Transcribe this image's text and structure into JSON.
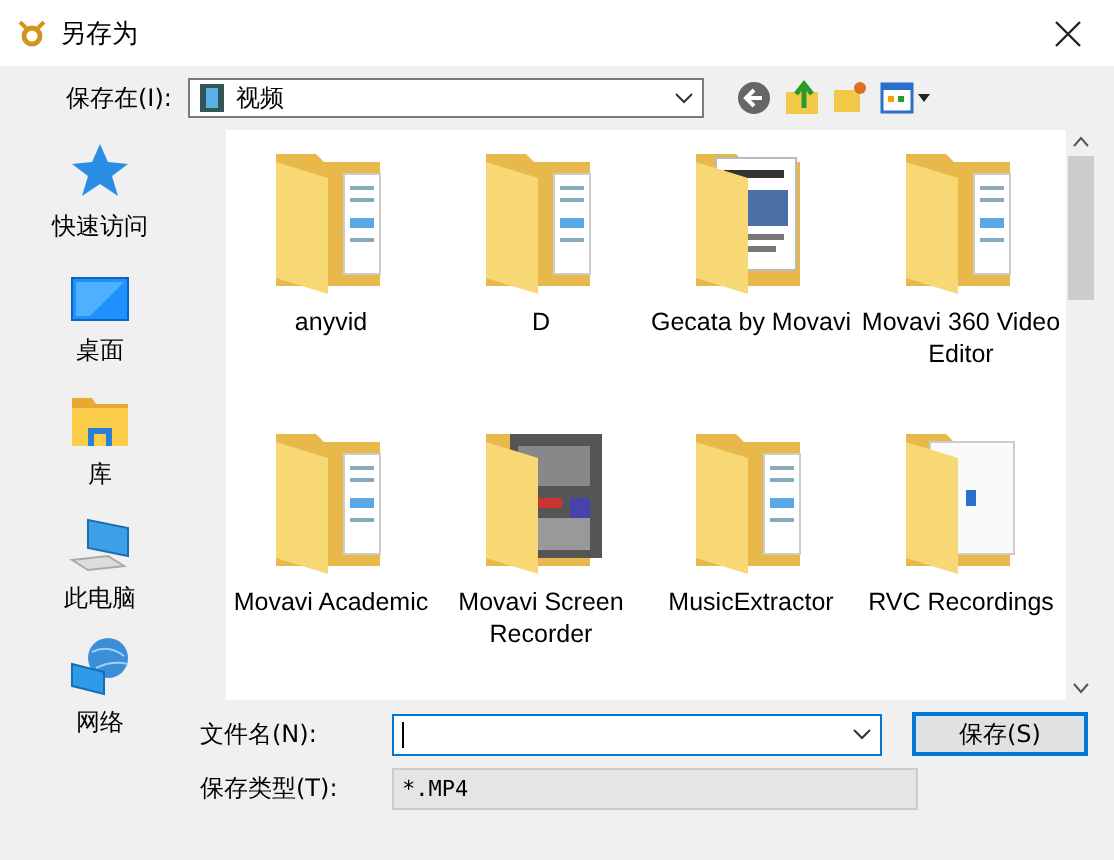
{
  "window": {
    "title": "另存为"
  },
  "location": {
    "label": "保存在(I):",
    "value": "视频"
  },
  "places": [
    {
      "label": "快速访问",
      "kind": "star"
    },
    {
      "label": "桌面",
      "kind": "desktop"
    },
    {
      "label": "库",
      "kind": "library"
    },
    {
      "label": "此电脑",
      "kind": "computer"
    },
    {
      "label": "网络",
      "kind": "network"
    }
  ],
  "files": [
    {
      "name": "anyvid",
      "kind": "folder"
    },
    {
      "name": "D",
      "kind": "folder"
    },
    {
      "name": "Gecata by Movavi",
      "kind": "document"
    },
    {
      "name": "Movavi 360 Video Editor",
      "kind": "folder"
    },
    {
      "name": "Movavi Academic",
      "kind": "folder"
    },
    {
      "name": "Movavi Screen Recorder",
      "kind": "photo"
    },
    {
      "name": "MusicExtractor",
      "kind": "folder"
    },
    {
      "name": "RVC Recordings",
      "kind": "papers"
    }
  ],
  "file_name": {
    "label": "文件名(N):"
  },
  "file_type": {
    "label": "保存类型(T):",
    "value": "*.MP4"
  },
  "save_button": "保存(S)"
}
